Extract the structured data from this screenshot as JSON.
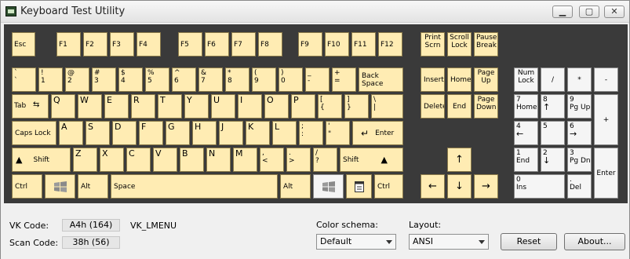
{
  "window": {
    "title": "Keyboard Test Utility",
    "min_icon": "minimize-icon",
    "max_icon": "maximize-icon",
    "close_icon": "close-icon"
  },
  "keys": {
    "esc": "Esc",
    "f1": "F1",
    "f2": "F2",
    "f3": "F3",
    "f4": "F4",
    "f5": "F5",
    "f6": "F6",
    "f7": "F7",
    "f8": "F8",
    "f9": "F9",
    "f10": "F10",
    "f11": "F11",
    "f12": "F12",
    "print_top": "Print",
    "print_bot": "Scrn",
    "scroll_top": "Scroll",
    "scroll_bot": "Lock",
    "pause_top": "Pause",
    "pause_bot": "Break",
    "backtick_top": "`",
    "backtick_bot": "`",
    "n1_top": "!",
    "n1_bot": "1",
    "n2_top": "@",
    "n2_bot": "2",
    "n3_top": "#",
    "n3_bot": "3",
    "n4_top": "$",
    "n4_bot": "4",
    "n5_top": "%",
    "n5_bot": "5",
    "n6_top": "^",
    "n6_bot": "6",
    "n7_top": "&",
    "n7_bot": "7",
    "n8_top": "*",
    "n8_bot": "8",
    "n9_top": "(",
    "n9_bot": "9",
    "n0_top": ")",
    "n0_bot": "0",
    "minus_top": "_",
    "minus_bot": "-",
    "equal_top": "+",
    "equal_bot": "=",
    "backspace": "Back Space",
    "tab": "Tab",
    "q": "Q",
    "w": "W",
    "e": "E",
    "r": "R",
    "t": "T",
    "y": "Y",
    "u": "U",
    "i": "I",
    "o": "O",
    "p": "P",
    "lbracket_top": "[",
    "lbracket_bot": "{",
    "rbracket_top": "]",
    "rbracket_bot": "}",
    "backslash_top": "\\",
    "backslash_bot": "|",
    "caps": "Caps Lock",
    "a": "A",
    "s": "S",
    "d": "D",
    "f": "F",
    "g": "G",
    "h": "H",
    "j": "J",
    "k": "K",
    "l": "L",
    "semicolon_top": ";",
    "semicolon_bot": ":",
    "quote_top": "'",
    "quote_bot": "\"",
    "enter": "Enter",
    "lshift": "Shift",
    "z": "Z",
    "x": "X",
    "c": "C",
    "v": "V",
    "b": "B",
    "n": "N",
    "m": "M",
    "comma_top": ",",
    "comma_bot": "<",
    "period_top": ".",
    "period_bot": ">",
    "slash_top": "/",
    "slash_bot": "?",
    "rshift": "Shift",
    "lctrl": "Ctrl",
    "lalt": "Alt",
    "space": "Space",
    "ralt": "Alt",
    "rctrl": "Ctrl",
    "insert": "Insert",
    "home": "Home",
    "pageup_top": "Page",
    "pageup_bot": "Up",
    "delete": "Delete",
    "end": "End",
    "pagedown_top": "Page",
    "pagedown_bot": "Down",
    "up": "↑",
    "left": "←",
    "down": "↓",
    "right": "→",
    "numlock_top": "Num",
    "numlock_bot": "Lock",
    "np_div": "/",
    "np_mul": "*",
    "np_minus": "-",
    "np_plus": "+",
    "np_enter": "Enter",
    "np7_top": "7",
    "np7_bot": "Home",
    "np8_top": "8",
    "np8_bot": "↑",
    "np9_top": "9",
    "np9_bot": "Pg Up",
    "np4_top": "4",
    "np4_bot": "←",
    "np5": "5",
    "np6_top": "6",
    "np6_bot": "→",
    "np1_top": "1",
    "np1_bot": "End",
    "np2_top": "2",
    "np2_bot": "↓",
    "np3_top": "3",
    "np3_bot": "Pg Dn",
    "np0_top": "0",
    "np0_bot": "Ins",
    "npdot_top": ".",
    "npdot_bot": "Del",
    "shift_icon": "triangle-up-icon",
    "tab_icon": "tab-arrows-icon",
    "enter_icon": "return-arrow-icon",
    "win_icon": "windows-logo-icon",
    "menu_icon": "context-menu-icon"
  },
  "status": {
    "vk_label": "VK Code:",
    "vk_value": "A4h (164)",
    "vk_name": "VK_LMENU",
    "scan_label": "Scan Code:",
    "scan_value": "38h (56)",
    "schema_label": "Color schema:",
    "schema_value": "Default",
    "layout_label": "Layout:",
    "layout_value": "ANSI",
    "reset": "Reset",
    "about": "About..."
  }
}
